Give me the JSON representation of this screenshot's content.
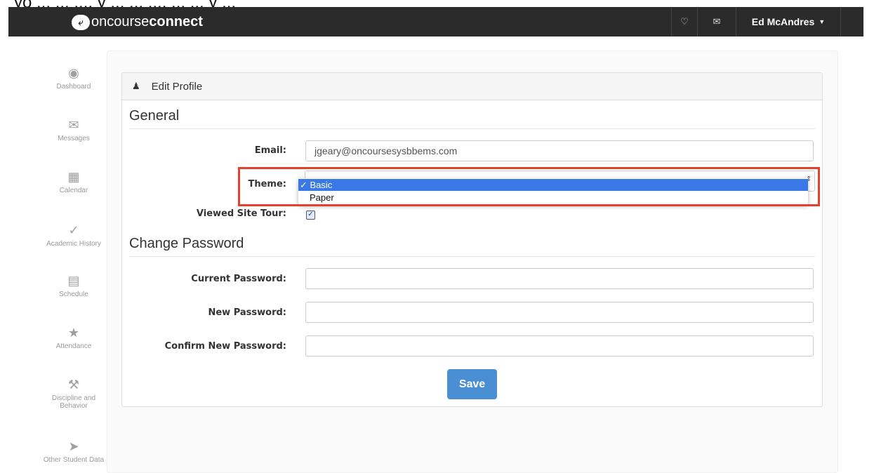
{
  "top_fragment": "yo ... ... ..., y ... ... ..., ... ... y ...",
  "navbar": {
    "brand_light": "oncourse",
    "brand_bold": "connect",
    "user_name": "Ed McAndres"
  },
  "sidebar": {
    "items": [
      {
        "label": "Dashboard",
        "icon": "dashboard-icon"
      },
      {
        "label": "Messages",
        "icon": "envelope-icon"
      },
      {
        "label": "Calendar",
        "icon": "calendar-icon"
      },
      {
        "label": "Academic History",
        "icon": "check-icon"
      },
      {
        "label": "Schedule",
        "icon": "list-icon"
      },
      {
        "label": "Attendance",
        "icon": "star-icon"
      },
      {
        "label": "Discipline and Behavior",
        "icon": "gavel-icon"
      },
      {
        "label": "Other Student Data",
        "icon": "tag-icon"
      }
    ]
  },
  "card": {
    "title": "Edit Profile",
    "general_title": "General",
    "email_label": "Email:",
    "email_value": "jgeary@oncoursesysbbems.com",
    "theme_label": "Theme:",
    "theme_options": [
      {
        "label": "✓ Basic",
        "selected": true
      },
      {
        "label": "Paper",
        "selected": false
      }
    ],
    "viewed_tour_label": "Viewed Site Tour:",
    "viewed_tour_checked": true,
    "password_title": "Change Password",
    "current_password_label": "Current Password:",
    "new_password_label": "New Password:",
    "confirm_password_label": "Confirm New Password:",
    "save_label": "Save"
  },
  "colors": {
    "navbar": "#2b2b2b",
    "primary_button": "#4a8fd4",
    "selected_option": "#3b78e7",
    "highlight_box": "#e6402f"
  }
}
